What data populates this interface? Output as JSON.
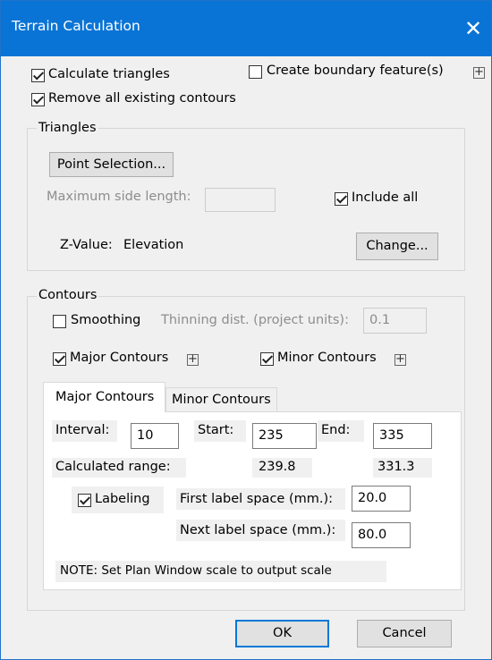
{
  "window": {
    "title": "Terrain Calculation",
    "close_glyph": "✕"
  },
  "top": {
    "calculate_triangles": {
      "label": "Calculate triangles",
      "checked": true
    },
    "remove_contours": {
      "label": "Remove all existing contours",
      "checked": true
    },
    "create_boundary": {
      "label": "Create boundary feature(s)",
      "checked": false
    },
    "expand_glyph": "+"
  },
  "triangles": {
    "title": "Triangles",
    "point_selection_label": "Point Selection...",
    "max_side_label": "Maximum side length:",
    "max_side_value": "",
    "include_all": {
      "label": "Include all",
      "checked": true
    },
    "zvalue_label": "Z-Value:",
    "zvalue_value": "Elevation",
    "change_label": "Change..."
  },
  "contours": {
    "title": "Contours",
    "smoothing": {
      "label": "Smoothing",
      "checked": false
    },
    "thinning_label": "Thinning dist. (project units):",
    "thinning_value": "0.1",
    "major": {
      "label": "Major Contours",
      "checked": true
    },
    "minor": {
      "label": "Minor Contours",
      "checked": true
    },
    "expand_glyph": "+",
    "tabs": [
      "Major Contours",
      "Minor Contours"
    ],
    "panel": {
      "interval_label": "Interval:",
      "interval_value": "10",
      "start_label": "Start:",
      "start_value": "235",
      "end_label": "End:",
      "end_value": "335",
      "calc_range_label": "Calculated range:",
      "calc_range_min": "239.8",
      "calc_range_max": "331.3",
      "labeling": {
        "label": "Labeling",
        "checked": true
      },
      "first_space_label": "First label space (mm.):",
      "first_space_value": "20.0",
      "next_space_label": "Next label space (mm.):",
      "next_space_value": "80.0",
      "note": "NOTE: Set Plan Window scale to output scale"
    }
  },
  "footer": {
    "ok_label": "OK",
    "cancel_label": "Cancel"
  }
}
